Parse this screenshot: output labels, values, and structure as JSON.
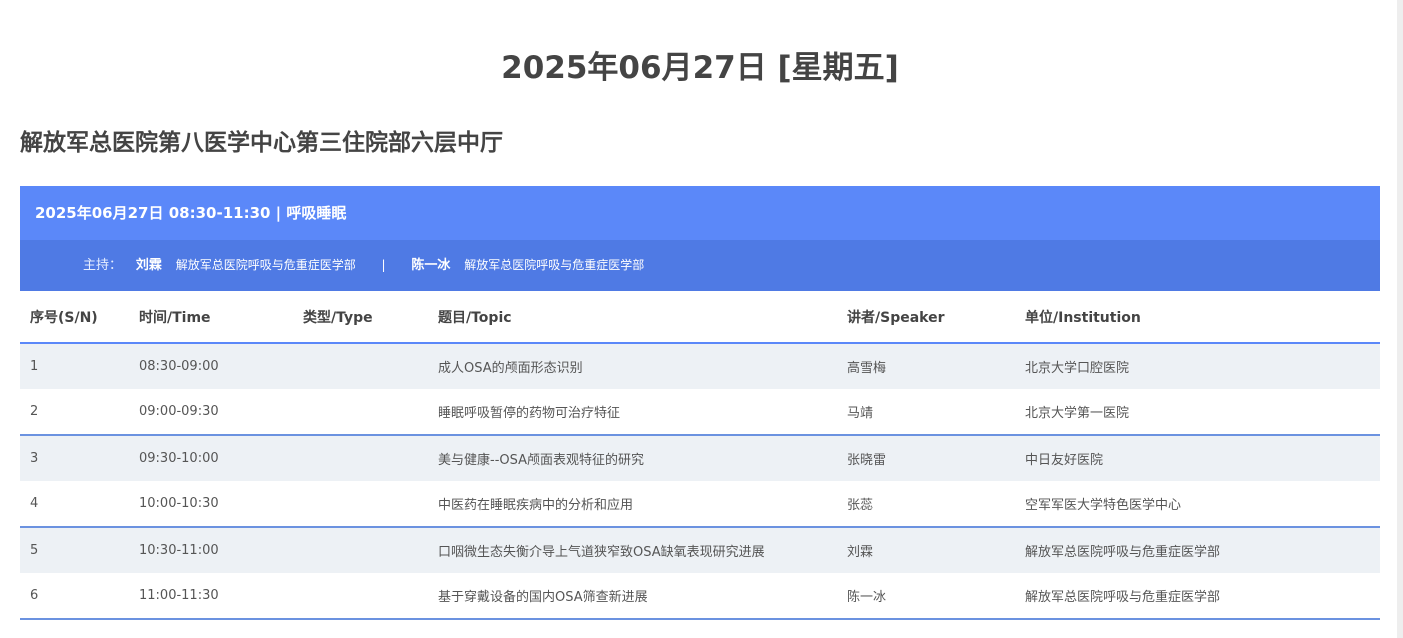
{
  "page": {
    "date_title": "2025年06月27日 [星期五]",
    "venue": "解放军总医院第八医学中心第三住院部六层中厅"
  },
  "session": {
    "header": "2025年06月27日 08:30-11:30 | 呼吸睡眠",
    "host_label": "主持：",
    "hosts": [
      {
        "name": "刘霖",
        "institution": "解放军总医院呼吸与危重症医学部"
      },
      {
        "name": "陈一冰",
        "institution": "解放军总医院呼吸与危重症医学部"
      }
    ],
    "separator": "|"
  },
  "table": {
    "columns": [
      "序号(S/N)",
      "时间/Time",
      "类型/Type",
      "题目/Topic",
      "讲者/Speaker",
      "单位/Institution"
    ],
    "rows": [
      {
        "sn": "1",
        "time": "08:30-09:00",
        "type": "",
        "topic": "成人OSA的颅面形态识别",
        "speaker": "高雪梅",
        "institution": "北京大学口腔医院"
      },
      {
        "sn": "2",
        "time": "09:00-09:30",
        "type": "",
        "topic": "睡眠呼吸暂停的药物可治疗特征",
        "speaker": "马靖",
        "institution": "北京大学第一医院"
      },
      {
        "sn": "3",
        "time": "09:30-10:00",
        "type": "",
        "topic": "美与健康--OSA颅面表观特征的研究",
        "speaker": "张晓雷",
        "institution": "中日友好医院"
      },
      {
        "sn": "4",
        "time": "10:00-10:30",
        "type": "",
        "topic": "中医药在睡眠疾病中的分析和应用",
        "speaker": "张蕊",
        "institution": "空军军医大学特色医学中心"
      },
      {
        "sn": "5",
        "time": "10:30-11:00",
        "type": "",
        "topic": "口咽微生态失衡介导上气道狭窄致OSA缺氧表现研究进展",
        "speaker": "刘霖",
        "institution": "解放军总医院呼吸与危重症医学部"
      },
      {
        "sn": "6",
        "time": "11:00-11:30",
        "type": "",
        "topic": "基于穿戴设备的国内OSA筛查新进展",
        "speaker": "陈一冰",
        "institution": "解放军总医院呼吸与危重症医学部"
      }
    ]
  },
  "colors": {
    "session_bar": "#5b88f9",
    "host_bar": "#4f7ae4",
    "row_stripe": "#edf1f5"
  }
}
